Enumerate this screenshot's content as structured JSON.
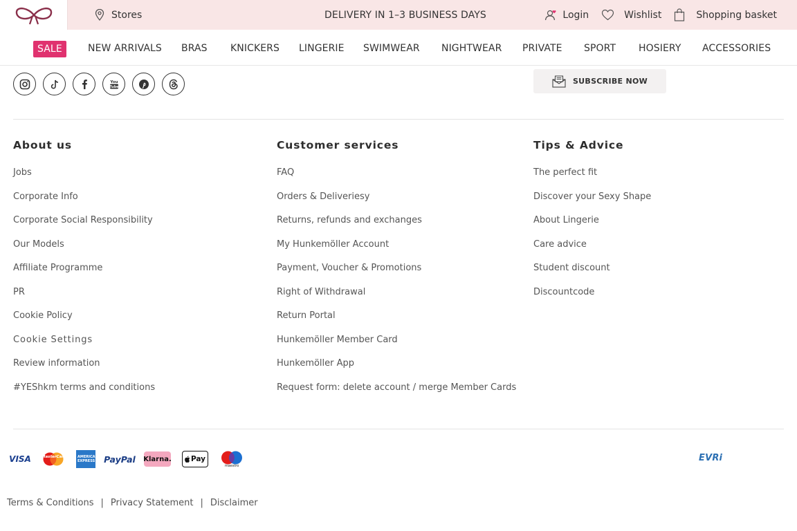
{
  "header": {
    "logo_icon": "bow-logo-icon",
    "stores_label": "Stores",
    "delivery_text": "DELIVERY IN 1–3 BUSINESS DAYS",
    "login_label": "Login",
    "wishlist_label": "Wishlist",
    "basket_label": "Shopping basket",
    "background_color": "#f9e6e6"
  },
  "nav": {
    "items": [
      {
        "label": "SALE"
      },
      {
        "label": "NEW ARRIVALS"
      },
      {
        "label": "BRAS"
      },
      {
        "label": "KNICKERS"
      },
      {
        "label": "LINGERIE"
      },
      {
        "label": "SWIMWEAR"
      },
      {
        "label": "NIGHTWEAR"
      },
      {
        "label": "PRIVATE"
      },
      {
        "label": "SPORT"
      },
      {
        "label": "HOSIERY"
      },
      {
        "label": "ACCESSORIES"
      }
    ],
    "sale_color": "#e0326f"
  },
  "social": {
    "icons": [
      "instagram-icon",
      "tiktok-icon",
      "facebook-icon",
      "youtube-icon",
      "pinterest-icon",
      "threads-icon"
    ]
  },
  "subscribe": {
    "label": "SUBSCRIBE NOW",
    "icon": "newsletter-icon"
  },
  "footer": {
    "columns": [
      {
        "title": "About us",
        "links": [
          "Jobs",
          "Corporate Info",
          "Corporate Social Responsibility",
          "Our Models",
          "Affiliate Programme",
          "PR",
          "Cookie Policy",
          "Cookie Settings",
          "Review information",
          "#YEShkm terms and conditions"
        ]
      },
      {
        "title": "Customer services",
        "links": [
          "FAQ",
          "Orders & Deliveriesy",
          "Returns, refunds and exchanges",
          "My Hunkemöller Account",
          "Payment, Voucher & Promotions",
          "Right of Withdrawal",
          "Return Portal",
          "Hunkemöller Member Card",
          "Hunkemöller App",
          "Request form: delete account / merge Member Cards"
        ]
      },
      {
        "title": "Tips & Advice",
        "links": [
          "The perfect fit",
          "Discover your Sexy Shape",
          "About Lingerie",
          "Care advice",
          "Student discount",
          "Discountcode"
        ]
      }
    ]
  },
  "payments": {
    "visa": "VISA",
    "mastercard": "MasterCard",
    "amex": "AMERICAN EXPRESS",
    "paypal": "PayPal",
    "klarna": "Klarna.",
    "applepay": "Pay",
    "maestro": "maestro",
    "carrier": "EVRi"
  },
  "legal": {
    "terms": "Terms & Conditions",
    "privacy": "Privacy Statement",
    "disclaimer": "Disclaimer",
    "separator": "|"
  }
}
